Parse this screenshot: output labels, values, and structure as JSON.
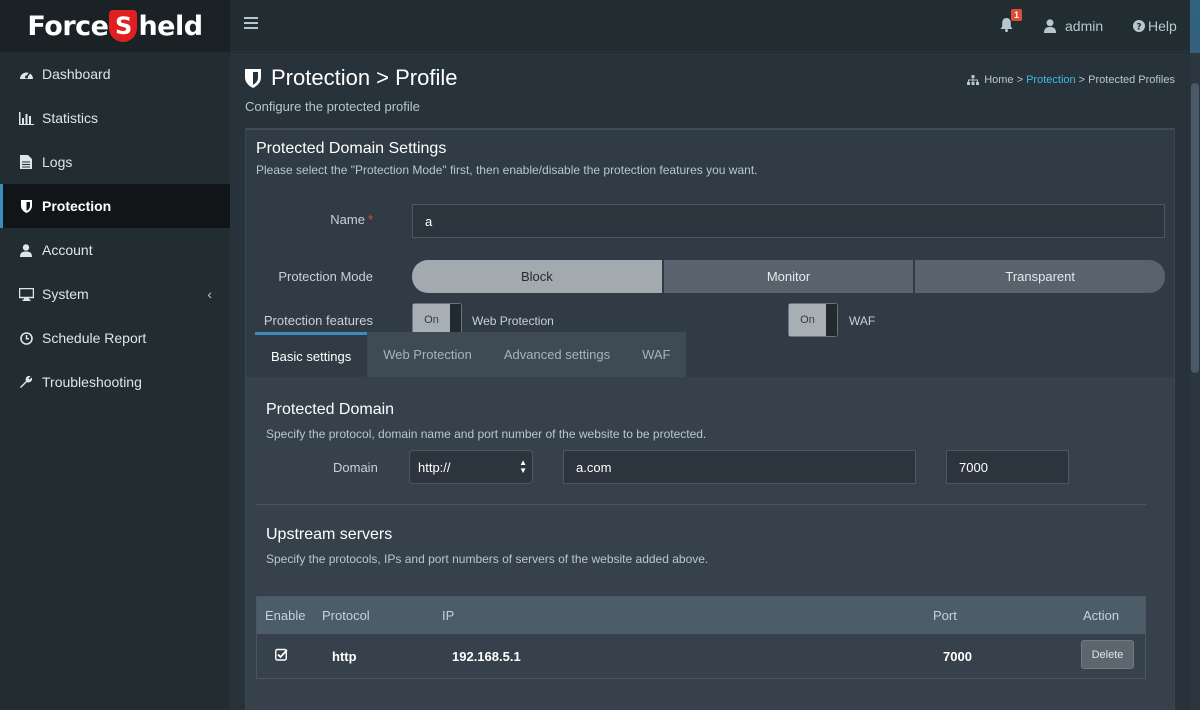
{
  "brand": {
    "name_prefix": "Force",
    "name_letter": "S",
    "name_suffix": "held"
  },
  "header": {
    "notifications_count": "1",
    "user": "admin",
    "help": "Help"
  },
  "sidebar": {
    "items": [
      {
        "label": "Dashboard",
        "icon": "dashboard-icon"
      },
      {
        "label": "Statistics",
        "icon": "bar-chart-icon"
      },
      {
        "label": "Logs",
        "icon": "file-icon"
      },
      {
        "label": "Protection",
        "icon": "shield-icon",
        "active": true
      },
      {
        "label": "Account",
        "icon": "user-icon"
      },
      {
        "label": "System",
        "icon": "monitor-icon",
        "has_submenu": true
      },
      {
        "label": "Schedule Report",
        "icon": "clock-icon"
      },
      {
        "label": "Troubleshooting",
        "icon": "wrench-icon"
      }
    ]
  },
  "page": {
    "title": "Protection > Profile",
    "subtitle": "Configure the protected profile",
    "breadcrumb": {
      "home": "Home",
      "sep1": " > ",
      "section": "Protection",
      "sep2": " > ",
      "current": "Protected Profiles"
    }
  },
  "settings": {
    "title": "Protected Domain Settings",
    "subtitle": "Please select the \"Protection Mode\" first, then enable/disable the protection features you want.",
    "name_label": "Name",
    "name_required": "*",
    "name_value": "a",
    "mode_label": "Protection Mode",
    "modes": [
      "Block",
      "Monitor",
      "Transparent"
    ],
    "selected_mode": "Block",
    "features_label": "Protection features",
    "features": [
      {
        "state": "On",
        "label": "Web Protection"
      },
      {
        "state": "On",
        "label": "WAF"
      }
    ]
  },
  "tabs": [
    "Basic settings",
    "Web Protection",
    "Advanced settings",
    "WAF"
  ],
  "active_tab": "Basic settings",
  "protected_domain": {
    "title": "Protected Domain",
    "subtitle": "Specify the protocol, domain name and port number of the website to be protected.",
    "domain_label": "Domain",
    "protocol": "http://",
    "domain": "a.com",
    "port": "7000"
  },
  "upstream": {
    "title": "Upstream servers",
    "subtitle": "Specify the protocols, IPs and port numbers of servers of the website added above.",
    "columns": [
      "Enable",
      "Protocol",
      "IP",
      "Port",
      "Action"
    ],
    "rows": [
      {
        "enabled": true,
        "protocol": "http",
        "ip": "192.168.5.1",
        "port": "7000",
        "action": "Delete"
      }
    ]
  }
}
